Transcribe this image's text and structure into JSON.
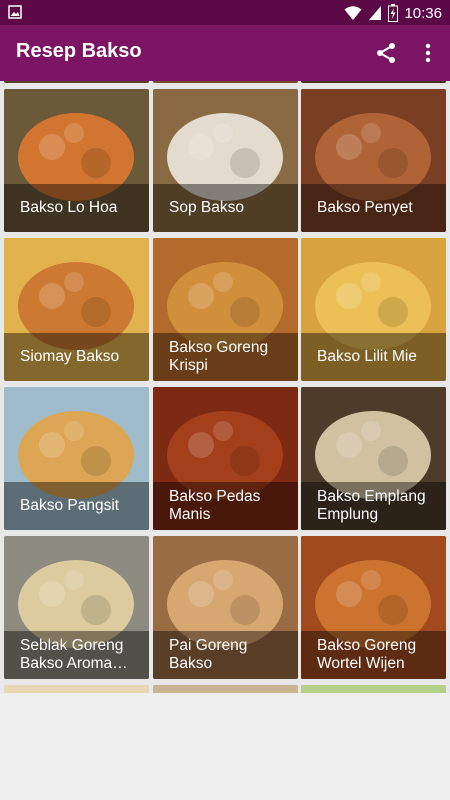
{
  "app": {
    "title": "Resep Bakso",
    "status_time": "10:36"
  },
  "recipes": [
    {
      "label": "Bakso Lo Hoa",
      "bg": "#6b5a3a",
      "accent": "#e37a2f"
    },
    {
      "label": "Sop Bakso",
      "bg": "#8a6a42",
      "accent": "#f1efe6"
    },
    {
      "label": "Bakso Penyet",
      "bg": "#7a3f22",
      "accent": "#b86a3a"
    },
    {
      "label": "Siomay Bakso",
      "bg": "#e2b24e",
      "accent": "#c8702e"
    },
    {
      "label": "Bakso Goreng\nKrispi",
      "bg": "#b46a2a",
      "accent": "#d6953f"
    },
    {
      "label": "Bakso Lilit Mie",
      "bg": "#d8a33f",
      "accent": "#f0c55b"
    },
    {
      "label": "Bakso Pangsit",
      "bg": "#9fbccc",
      "accent": "#e6a23e"
    },
    {
      "label": "Bakso Pedas\nManis",
      "bg": "#7e2a12",
      "accent": "#a9431c"
    },
    {
      "label": "Bakso Emplang\nEmplung",
      "bg": "#4f3b2a",
      "accent": "#e8d9b6"
    },
    {
      "label": "Seblak Goreng\nBakso Aroma…",
      "bg": "#8d8a80",
      "accent": "#e9d6a3"
    },
    {
      "label": "Pai Goreng\nBakso",
      "bg": "#9a6c44",
      "accent": "#e2b27a"
    },
    {
      "label": "Bakso Goreng\nWortel Wijen",
      "bg": "#a04a1e",
      "accent": "#d37a32"
    }
  ]
}
